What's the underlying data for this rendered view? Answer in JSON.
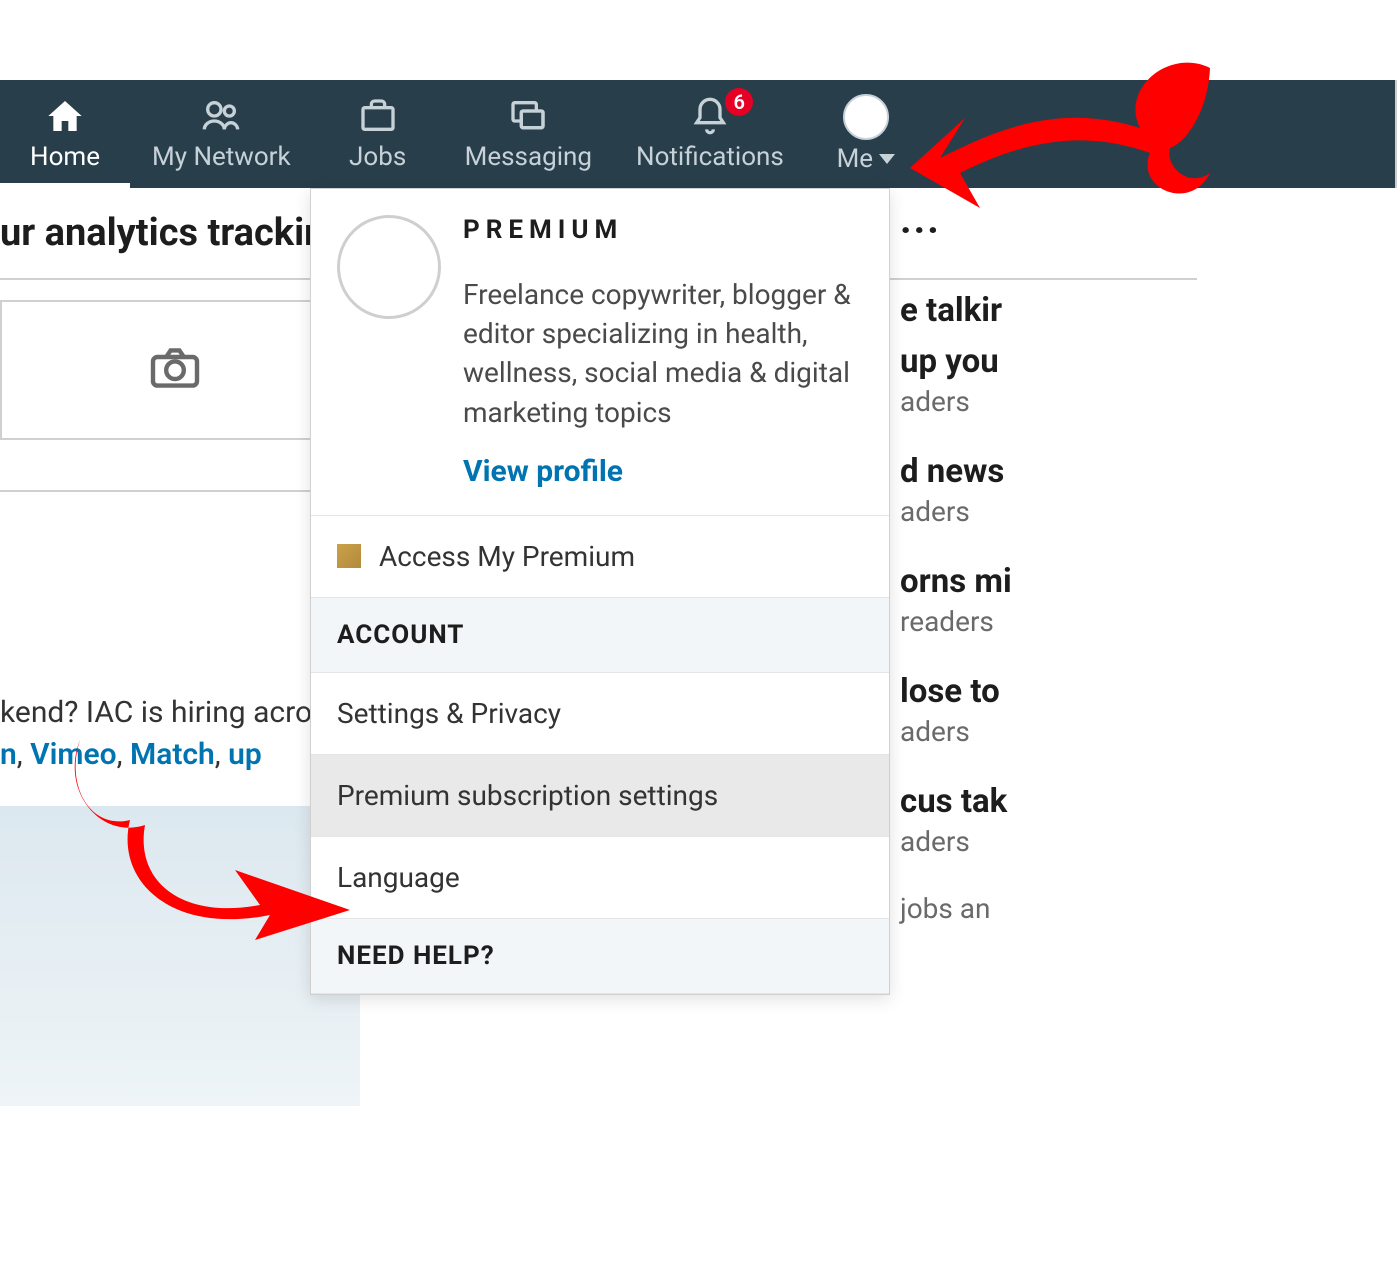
{
  "nav": {
    "home": "Home",
    "network": "My Network",
    "jobs": "Jobs",
    "messaging": "Messaging",
    "notifications": "Notifications",
    "notif_count": "6",
    "me": "Me"
  },
  "subnav": {
    "text": "ur analytics tracking,"
  },
  "feed": {
    "line1": "kend? IAC is hiring acros",
    "link_n": "n",
    "link_sep": ", ",
    "link_vimeo": "Vimeo",
    "link_match": "Match",
    "link_up": "up"
  },
  "dropdown": {
    "premium": "PREMIUM",
    "headline": "Freelance copywriter, blogger & editor specializing in health, wellness, social media & digital marketing topics",
    "view_profile": "View profile",
    "access_premium": "Access My Premium",
    "section_account": "ACCOUNT",
    "settings_privacy": "Settings & Privacy",
    "premium_sub": "Premium subscription settings",
    "language": "Language",
    "section_help": "NEED HELP?"
  },
  "right": {
    "dots": "...",
    "i0_head": "e talkir",
    "i1_head": "up you",
    "i1_sub": "aders",
    "i2_head": "d news",
    "i2_sub": "aders",
    "i3_head": "orns mi",
    "i3_sub": " readers",
    "i4_head": "lose to",
    "i4_sub": "aders",
    "i5_head": "cus tak",
    "i5_sub": "aders",
    "tail": " jobs an"
  }
}
